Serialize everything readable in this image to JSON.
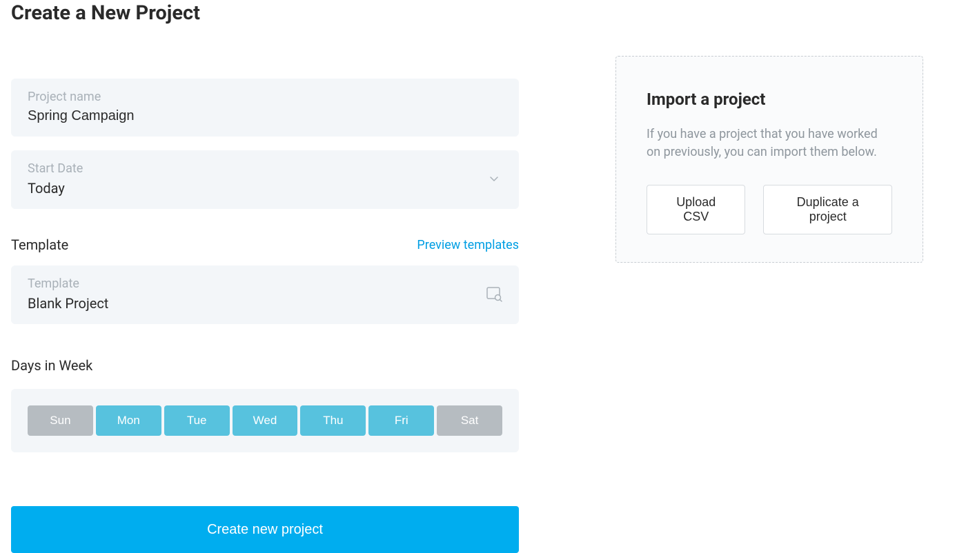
{
  "page": {
    "title": "Create a New Project"
  },
  "form": {
    "projectName": {
      "label": "Project name",
      "value": "Spring Campaign"
    },
    "startDate": {
      "label": "Start Date",
      "value": "Today"
    },
    "template": {
      "sectionTitle": "Template",
      "previewLink": "Preview templates",
      "label": "Template",
      "value": "Blank Project"
    },
    "days": {
      "title": "Days in Week",
      "items": [
        {
          "label": "Sun",
          "active": false
        },
        {
          "label": "Mon",
          "active": true
        },
        {
          "label": "Tue",
          "active": true
        },
        {
          "label": "Wed",
          "active": true
        },
        {
          "label": "Thu",
          "active": true
        },
        {
          "label": "Fri",
          "active": true
        },
        {
          "label": "Sat",
          "active": false
        }
      ]
    },
    "submitLabel": "Create new project"
  },
  "importPanel": {
    "title": "Import a project",
    "description": "If you have a project that you have worked on previously, you can import them below.",
    "uploadLabel": "Upload CSV",
    "duplicateLabel": "Duplicate a project"
  }
}
